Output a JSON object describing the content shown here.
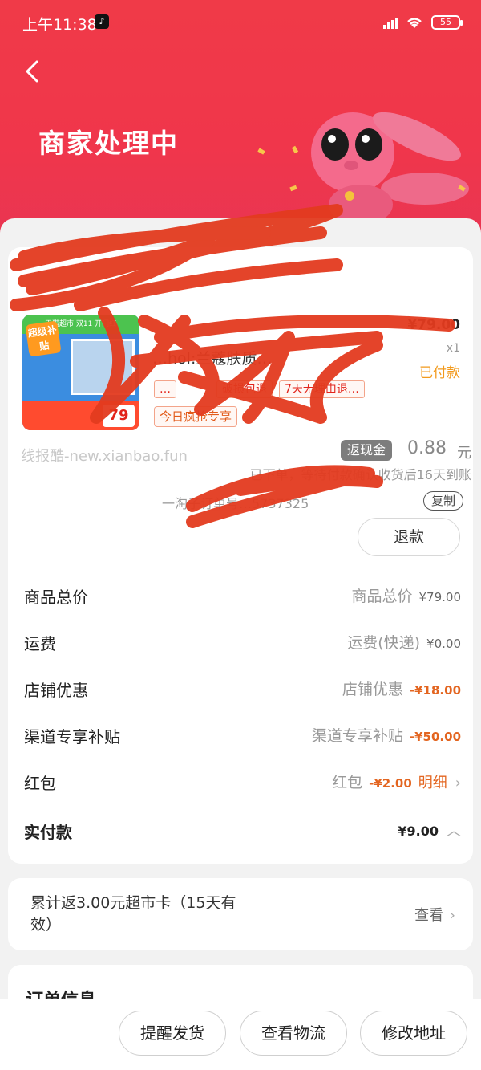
{
  "status_bar": {
    "time": "上午11:38",
    "app_icon": "tiktok-icon",
    "battery": "55"
  },
  "header": {
    "back_icon": "chevron-left-icon",
    "title": "商家处理中"
  },
  "product": {
    "image_top_text": "天猫超市 双11 开门红",
    "image_badge": "超级补贴",
    "image_price": "79",
    "title": "…hol:兰蔻肤质…",
    "price": "¥79.00",
    "quantity": "x1",
    "status": "已付款",
    "tags": [
      "…",
      "破损包退",
      "7天无理由退…"
    ],
    "promo_tag": "今日疯抢专享"
  },
  "rebate": {
    "watermark": "线报酷-new.xianbao.fun",
    "cash_label": "返现金",
    "cash_value": "0.88",
    "cash_unit": "元",
    "pending_text": "已下单，等待付款确认收货后16天到账",
    "taokouling": "一淘子订单号…5737325",
    "copy_label": "复制",
    "refund_label": "退款"
  },
  "price_rows": [
    {
      "label": "商品总价",
      "desc": "商品总价",
      "value": "¥79.00",
      "negative": false
    },
    {
      "label": "运费",
      "desc": "运费(快递)",
      "value": "¥0.00",
      "negative": false
    },
    {
      "label": "店铺优惠",
      "desc": "店铺优惠",
      "value": "-¥18.00",
      "negative": true
    },
    {
      "label": "渠道专享补贴",
      "desc": "渠道专享补贴",
      "value": "-¥50.00",
      "negative": true
    },
    {
      "label": "红包",
      "desc": "红包",
      "value": "-¥2.00",
      "negative": true,
      "link": "明细"
    }
  ],
  "paid_row": {
    "label": "实付款",
    "value": "¥9.00"
  },
  "supermarket_card": {
    "text": "累计返3.00元超市卡（15天有效）",
    "link": "查看"
  },
  "order_info": {
    "title": "订单信息"
  },
  "bottom_actions": {
    "remind": "提醒发货",
    "logistics": "查看物流",
    "address": "修改地址"
  },
  "colors": {
    "header_red": "#f03a48",
    "accent_orange": "#e36520",
    "scribble_red": "#e33b1f"
  }
}
